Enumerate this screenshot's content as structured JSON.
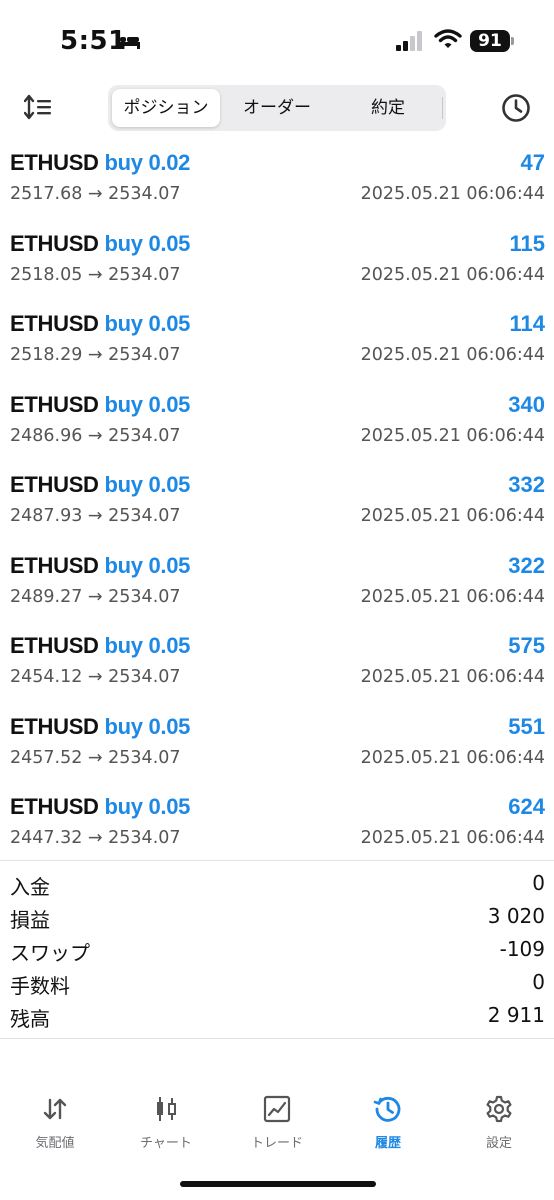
{
  "status_bar": {
    "time": "5:51",
    "battery": "91",
    "icons": [
      "bed-icon",
      "signal-icon",
      "wifi-icon",
      "battery-icon"
    ]
  },
  "toolbar": {
    "segments": [
      "ポジション",
      "オーダー",
      "約定"
    ],
    "selected_segment": "ポジション",
    "left_icon": "sort-icon",
    "right_icon": "history-clock-icon"
  },
  "positions": [
    {
      "symbol": "ETHUSD",
      "side": "buy 0.02",
      "profit": "47",
      "price": "2517.68 → 2534.07",
      "time": "2025.05.21 06:06:44"
    },
    {
      "symbol": "ETHUSD",
      "side": "buy 0.05",
      "profit": "115",
      "price": "2518.05 → 2534.07",
      "time": "2025.05.21 06:06:44"
    },
    {
      "symbol": "ETHUSD",
      "side": "buy 0.05",
      "profit": "114",
      "price": "2518.29 → 2534.07",
      "time": "2025.05.21 06:06:44"
    },
    {
      "symbol": "ETHUSD",
      "side": "buy 0.05",
      "profit": "340",
      "price": "2486.96 → 2534.07",
      "time": "2025.05.21 06:06:44"
    },
    {
      "symbol": "ETHUSD",
      "side": "buy 0.05",
      "profit": "332",
      "price": "2487.93 → 2534.07",
      "time": "2025.05.21 06:06:44"
    },
    {
      "symbol": "ETHUSD",
      "side": "buy 0.05",
      "profit": "322",
      "price": "2489.27 → 2534.07",
      "time": "2025.05.21 06:06:44"
    },
    {
      "symbol": "ETHUSD",
      "side": "buy 0.05",
      "profit": "575",
      "price": "2454.12 → 2534.07",
      "time": "2025.05.21 06:06:44"
    },
    {
      "symbol": "ETHUSD",
      "side": "buy 0.05",
      "profit": "551",
      "price": "2457.52 → 2534.07",
      "time": "2025.05.21 06:06:44"
    },
    {
      "symbol": "ETHUSD",
      "side": "buy 0.05",
      "profit": "624",
      "price": "2447.32 → 2534.07",
      "time": "2025.05.21 06:06:44"
    }
  ],
  "summary": [
    {
      "label": "入金",
      "value": "0"
    },
    {
      "label": "損益",
      "value": "3 020"
    },
    {
      "label": "スワップ",
      "value": "-109"
    },
    {
      "label": "手数料",
      "value": "0"
    },
    {
      "label": "残高",
      "value": "2 911"
    }
  ],
  "tabs": [
    {
      "label": "気配値",
      "icon": "quotes-arrows-icon",
      "active": false
    },
    {
      "label": "チャート",
      "icon": "candlestick-icon",
      "active": false
    },
    {
      "label": "トレード",
      "icon": "trade-chart-icon",
      "active": false
    },
    {
      "label": "履歴",
      "icon": "history-icon",
      "active": true
    },
    {
      "label": "設定",
      "icon": "gear-icon",
      "active": false
    }
  ],
  "colors": {
    "accent": "#1e88e5",
    "text": "#111111",
    "secondary_text": "#555555",
    "tab_inactive": "#6d6d72",
    "segment_bg": "#ececee"
  }
}
